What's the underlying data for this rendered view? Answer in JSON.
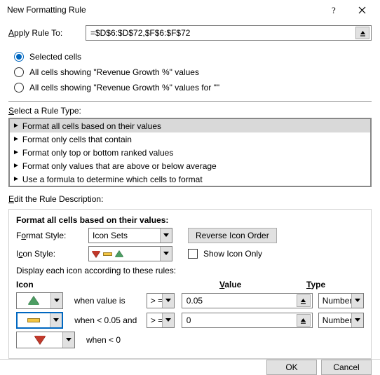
{
  "window": {
    "title": "New Formatting Rule"
  },
  "applyRule": {
    "label": "Apply Rule To:",
    "range": "=$D$6:$D$72,$F$6:$F$72"
  },
  "scope": {
    "selected_index": 0,
    "options": [
      "Selected cells",
      "All cells showing \"Revenue Growth %\" values",
      "All cells showing \"Revenue Growth %\" values for \"\""
    ]
  },
  "ruleType": {
    "label": "Select a Rule Type:",
    "selected_index": 0,
    "items": [
      "Format all cells based on their values",
      "Format only cells that contain",
      "Format only top or bottom ranked values",
      "Format only values that are above or below average",
      "Use a formula to determine which cells to format"
    ]
  },
  "desc": {
    "label": "Edit the Rule Description:",
    "heading": "Format all cells based on their values:",
    "formatStyleLabel": "Format Style:",
    "formatStyleValue": "Icon Sets",
    "reverseLabel": "Reverse Icon Order",
    "iconStyleLabel": "Icon Style:",
    "showIconOnlyLabel": "Show Icon Only",
    "rulesLabel": "Display each icon according to these rules:",
    "columns": {
      "icon": "Icon",
      "value": "Value",
      "type": "Type"
    },
    "rules": [
      {
        "icon": "green-up",
        "condText": "when value is",
        "op": "> =",
        "value": "0.05",
        "type": "Number"
      },
      {
        "icon": "yellow-bar",
        "condText": "when < 0.05 and",
        "op": "> =",
        "value": "0",
        "type": "Number"
      },
      {
        "icon": "red-down",
        "condText": "when < 0",
        "op": "",
        "value": "",
        "type": ""
      }
    ]
  },
  "buttons": {
    "ok": "OK",
    "cancel": "Cancel"
  }
}
